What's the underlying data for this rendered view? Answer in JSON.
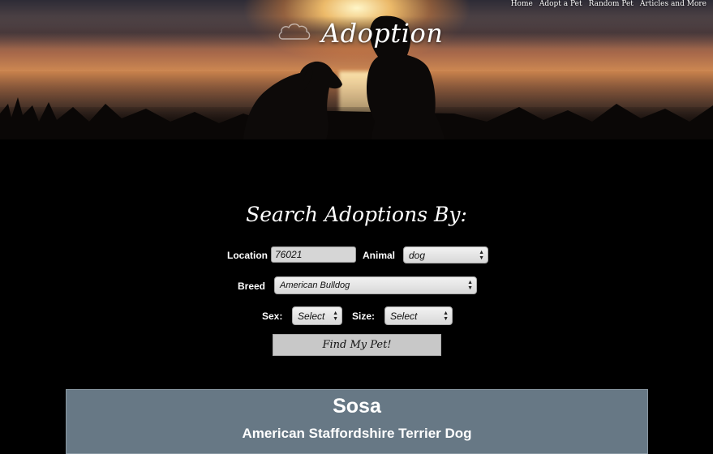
{
  "site": {
    "title": "Adoption"
  },
  "nav": {
    "items": [
      "Home",
      "Adopt a Pet",
      "Random Pet",
      "Articles and More"
    ]
  },
  "search": {
    "heading": "Search Adoptions By:",
    "location_label": "Location",
    "location_value": "76021",
    "animal_label": "Animal",
    "animal_selected": "dog",
    "breed_label": "Breed",
    "breed_selected": "American Bulldog",
    "sex_label": "Sex:",
    "sex_selected": "Select",
    "size_label": "Size:",
    "size_selected": "Select",
    "submit_label": "Find My Pet!"
  },
  "result": {
    "name": "Sosa",
    "breed": "American Staffordshire Terrier Dog"
  },
  "colors": {
    "page_bg": "#000000",
    "card_bg": "#677885",
    "button_bg": "#c8c8c8"
  }
}
